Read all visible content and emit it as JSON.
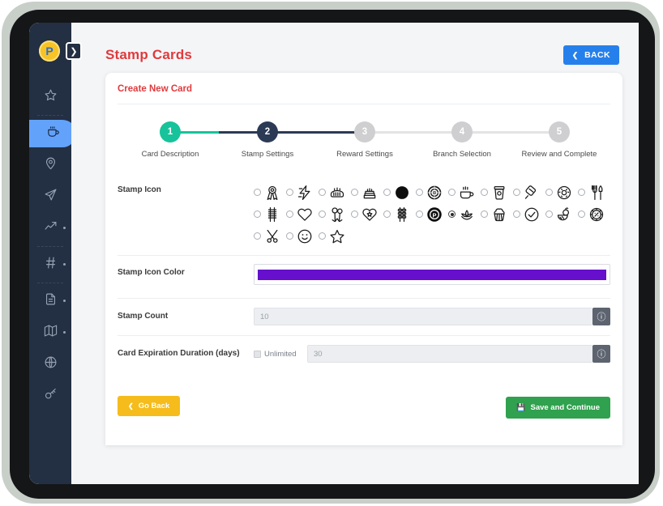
{
  "app": {
    "logo_letter": "P",
    "sidebar_toggle_icon": "chevron-right-icon"
  },
  "sidebar": {
    "items": [
      {
        "icon": "star-icon",
        "name": "favorites",
        "active": false,
        "dot": false,
        "sep_after": true
      },
      {
        "icon": "coffee-cup-icon",
        "name": "loyalty",
        "active": true,
        "dot": false,
        "sep_after": false
      },
      {
        "icon": "map-pin-icon",
        "name": "locations",
        "active": false,
        "dot": false,
        "sep_after": false
      },
      {
        "icon": "send-icon",
        "name": "campaigns",
        "active": false,
        "dot": false,
        "sep_after": false
      },
      {
        "icon": "trending-up-icon",
        "name": "analytics",
        "active": false,
        "dot": true,
        "sep_after": true
      },
      {
        "icon": "hash-icon",
        "name": "tags",
        "active": false,
        "dot": true,
        "sep_after": true
      },
      {
        "icon": "file-icon",
        "name": "reports",
        "active": false,
        "dot": true,
        "sep_after": false
      },
      {
        "icon": "map-icon",
        "name": "map",
        "active": false,
        "dot": true,
        "sep_after": false
      },
      {
        "icon": "globe-icon",
        "name": "web",
        "active": false,
        "dot": false,
        "sep_after": false
      },
      {
        "icon": "key-icon",
        "name": "access",
        "active": false,
        "dot": false,
        "sep_after": false
      }
    ]
  },
  "header": {
    "title": "Stamp Cards",
    "back_button": {
      "label": "BACK",
      "icon": "chevron-left-icon"
    }
  },
  "panel": {
    "title": "Create New Card"
  },
  "stepper": {
    "steps": [
      {
        "number": "1",
        "label": "Card Description",
        "state": "done"
      },
      {
        "number": "2",
        "label": "Stamp Settings",
        "state": "active"
      },
      {
        "number": "3",
        "label": "Reward Settings",
        "state": "todo"
      },
      {
        "number": "4",
        "label": "Branch Selection",
        "state": "todo"
      },
      {
        "number": "5",
        "label": "Review and Complete",
        "state": "todo"
      }
    ],
    "colors": {
      "done": "#17c39a",
      "active": "#2b3a55",
      "todo": "#cfcfd1"
    }
  },
  "form": {
    "stamp_icon": {
      "label": "Stamp Icon",
      "selected_index": 17,
      "options": [
        {
          "icon": "award-ribbon-icon"
        },
        {
          "icon": "lightning-bolt-icon"
        },
        {
          "icon": "bread-loaf-icon"
        },
        {
          "icon": "layer-cake-icon"
        },
        {
          "icon": "filled-circle-icon"
        },
        {
          "icon": "dartboard-target-icon"
        },
        {
          "icon": "hot-coffee-cup-icon"
        },
        {
          "icon": "togo-coffee-cup-icon"
        },
        {
          "icon": "ice-cream-bar-icon"
        },
        {
          "icon": "donut-icon"
        },
        {
          "icon": "fork-knife-icon"
        },
        {
          "icon": "chopsticks-icon"
        },
        {
          "icon": "heart-icon"
        },
        {
          "icon": "balloons-icon"
        },
        {
          "icon": "heart-star-icon"
        },
        {
          "icon": "kebab-skewer-icon"
        },
        {
          "icon": "p-badge-icon"
        },
        {
          "icon": "lotus-icon"
        },
        {
          "icon": "cupcake-icon"
        },
        {
          "icon": "check-circle-icon"
        },
        {
          "icon": "fruit-bowl-icon"
        },
        {
          "icon": "percent-badge-icon"
        },
        {
          "icon": "scissors-icon"
        },
        {
          "icon": "smiley-face-icon"
        },
        {
          "icon": "star-outline-icon"
        }
      ]
    },
    "stamp_icon_color": {
      "label": "Stamp Icon Color",
      "value": "#6610cd"
    },
    "stamp_count": {
      "label": "Stamp Count",
      "placeholder": "10",
      "value": "",
      "help_icon": "question-mark-icon"
    },
    "card_expiration": {
      "label": "Card Expiration Duration (days)",
      "unlimited_label": "Unlimited",
      "unlimited_checked": false,
      "placeholder": "30",
      "value": "",
      "help_icon": "question-mark-icon"
    }
  },
  "footer": {
    "go_back": {
      "label": "Go Back",
      "icon": "chevron-left-icon",
      "color": "#f5bc1b"
    },
    "save_continue": {
      "label": "Save and Continue",
      "icon": "save-disk-icon",
      "color": "#30a14e"
    }
  }
}
